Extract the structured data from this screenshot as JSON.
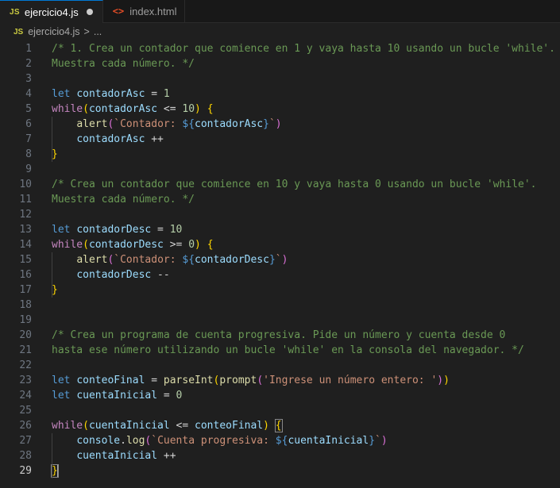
{
  "tabs": [
    {
      "icon": "JS",
      "label": "ejercicio4.js",
      "modified": true
    },
    {
      "icon": "<>",
      "label": "index.html"
    }
  ],
  "breadcrumb": {
    "icon": "JS",
    "file": "ejercicio4.js",
    "separator": ">",
    "rest": "..."
  },
  "colors": {
    "comment": "#6a9955",
    "keyword": "#569cd6",
    "control": "#c586c0",
    "variable": "#9cdcfe",
    "number": "#b5cea8",
    "function": "#dcdcaa",
    "string": "#ce9178",
    "bracket_l1": "#ffd700",
    "bracket_l2": "#da70d6",
    "active_tab_accent": "#0078d4"
  },
  "current_line": 29,
  "lines": [
    [
      [
        "c",
        "/* 1. Crea un contador que comience en 1 y vaya hasta 10 usando un bucle 'while'."
      ]
    ],
    [
      [
        "c",
        "Muestra cada número. */"
      ]
    ],
    [],
    [
      [
        "k",
        "let"
      ],
      [
        "o",
        " "
      ],
      [
        "v",
        "contadorAsc"
      ],
      [
        "o",
        " = "
      ],
      [
        "n",
        "1"
      ]
    ],
    [
      [
        "x",
        "while"
      ],
      [
        "b1",
        "("
      ],
      [
        "v",
        "contadorAsc"
      ],
      [
        "o",
        " <= "
      ],
      [
        "n",
        "10"
      ],
      [
        "b1",
        ")"
      ],
      [
        "o",
        " "
      ],
      [
        "b1",
        "{"
      ]
    ],
    [
      [
        "o",
        "    "
      ],
      [
        "f",
        "alert"
      ],
      [
        "b2",
        "("
      ],
      [
        "s",
        "`Contador: "
      ],
      [
        "t",
        "${"
      ],
      [
        "v",
        "contadorAsc"
      ],
      [
        "t",
        "}"
      ],
      [
        "s",
        "`"
      ],
      [
        "b2",
        ")"
      ]
    ],
    [
      [
        "o",
        "    "
      ],
      [
        "v",
        "contadorAsc"
      ],
      [
        "o",
        " ++"
      ]
    ],
    [
      [
        "b1",
        "}"
      ]
    ],
    [],
    [
      [
        "c",
        "/* Crea un contador que comience en 10 y vaya hasta 0 usando un bucle 'while'."
      ]
    ],
    [
      [
        "c",
        "Muestra cada número. */"
      ]
    ],
    [],
    [
      [
        "k",
        "let"
      ],
      [
        "o",
        " "
      ],
      [
        "v",
        "contadorDesc"
      ],
      [
        "o",
        " = "
      ],
      [
        "n",
        "10"
      ]
    ],
    [
      [
        "x",
        "while"
      ],
      [
        "b1",
        "("
      ],
      [
        "v",
        "contadorDesc"
      ],
      [
        "o",
        " >= "
      ],
      [
        "n",
        "0"
      ],
      [
        "b1",
        ")"
      ],
      [
        "o",
        " "
      ],
      [
        "b1",
        "{"
      ]
    ],
    [
      [
        "o",
        "    "
      ],
      [
        "f",
        "alert"
      ],
      [
        "b2",
        "("
      ],
      [
        "s",
        "`Contador: "
      ],
      [
        "t",
        "${"
      ],
      [
        "v",
        "contadorDesc"
      ],
      [
        "t",
        "}"
      ],
      [
        "s",
        "`"
      ],
      [
        "b2",
        ")"
      ]
    ],
    [
      [
        "o",
        "    "
      ],
      [
        "v",
        "contadorDesc"
      ],
      [
        "o",
        " --"
      ]
    ],
    [
      [
        "b1",
        "}"
      ]
    ],
    [],
    [],
    [
      [
        "c",
        "/* Crea un programa de cuenta progresiva. Pide un número y cuenta desde 0"
      ]
    ],
    [
      [
        "c",
        "hasta ese número utilizando un bucle 'while' en la consola del navegador. */"
      ]
    ],
    [],
    [
      [
        "k",
        "let"
      ],
      [
        "o",
        " "
      ],
      [
        "v",
        "conteoFinal"
      ],
      [
        "o",
        " = "
      ],
      [
        "f",
        "parseInt"
      ],
      [
        "b1",
        "("
      ],
      [
        "f",
        "prompt"
      ],
      [
        "b2",
        "("
      ],
      [
        "s",
        "'Ingrese un número entero: '"
      ],
      [
        "b2",
        ")"
      ],
      [
        "b1",
        ")"
      ]
    ],
    [
      [
        "k",
        "let"
      ],
      [
        "o",
        " "
      ],
      [
        "v",
        "cuentaInicial"
      ],
      [
        "o",
        " = "
      ],
      [
        "n",
        "0"
      ]
    ],
    [],
    [
      [
        "x",
        "while"
      ],
      [
        "b1",
        "("
      ],
      [
        "v",
        "cuentaInicial"
      ],
      [
        "o",
        " <= "
      ],
      [
        "v",
        "conteoFinal"
      ],
      [
        "b1",
        ")"
      ],
      [
        "o",
        " "
      ],
      [
        "B1",
        "{"
      ]
    ],
    [
      [
        "o",
        "    "
      ],
      [
        "v",
        "console"
      ],
      [
        "o",
        "."
      ],
      [
        "f",
        "log"
      ],
      [
        "b2",
        "("
      ],
      [
        "s",
        "`Cuenta progresiva: "
      ],
      [
        "t",
        "${"
      ],
      [
        "v",
        "cuentaInicial"
      ],
      [
        "t",
        "}"
      ],
      [
        "s",
        "`"
      ],
      [
        "b2",
        ")"
      ]
    ],
    [
      [
        "o",
        "    "
      ],
      [
        "v",
        "cuentaInicial"
      ],
      [
        "o",
        " ++"
      ]
    ],
    [
      [
        "B1",
        "}"
      ],
      [
        "cur",
        ""
      ]
    ]
  ]
}
